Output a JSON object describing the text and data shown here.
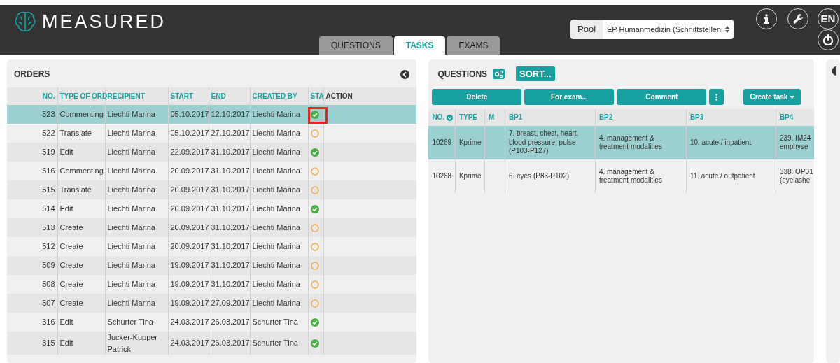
{
  "header": {
    "logo": "MEASURED",
    "tabs": [
      {
        "label": "QUESTIONS",
        "selected": false
      },
      {
        "label": "TASKS",
        "selected": true
      },
      {
        "label": "EXAMS",
        "selected": false
      }
    ],
    "pool": {
      "label": "Pool",
      "value": "EP Humanmedizin (Schnittstellen"
    },
    "language": "EN"
  },
  "orders": {
    "title": "ORDERS",
    "columns": [
      "NO.",
      "TYPE OF ORD",
      "RECIPIENT",
      "START",
      "END",
      "CREATED BY",
      "STA",
      "ACTION"
    ],
    "rows": [
      {
        "no": "523",
        "type": "Commenting",
        "recipient": "Liechti Marina",
        "start": "05.10.2017",
        "end": "12.10.2017",
        "created_by": "Liechti Marina",
        "completed": true,
        "selected": true,
        "highlighted": true
      },
      {
        "no": "522",
        "type": "Translate",
        "recipient": "Liechti Marina",
        "start": "05.10.2017",
        "end": "27.10.2017",
        "created_by": "Liechti Marina",
        "completed": false,
        "selected": false,
        "highlighted": false
      },
      {
        "no": "519",
        "type": "Edit",
        "recipient": "Liechti Marina",
        "start": "22.09.2017",
        "end": "31.10.2017",
        "created_by": "Liechti Marina",
        "completed": true,
        "selected": false,
        "highlighted": false
      },
      {
        "no": "516",
        "type": "Commenting",
        "recipient": "Liechti Marina",
        "start": "20.09.2017",
        "end": "31.10.2017",
        "created_by": "Liechti Marina",
        "completed": false,
        "selected": false,
        "highlighted": false
      },
      {
        "no": "515",
        "type": "Translate",
        "recipient": "Liechti Marina",
        "start": "20.09.2017",
        "end": "31.10.2017",
        "created_by": "Liechti Marina",
        "completed": false,
        "selected": false,
        "highlighted": false
      },
      {
        "no": "514",
        "type": "Edit",
        "recipient": "Liechti Marina",
        "start": "20.09.2017",
        "end": "31.10.2017",
        "created_by": "Liechti Marina",
        "completed": true,
        "selected": false,
        "highlighted": false
      },
      {
        "no": "513",
        "type": "Create",
        "recipient": "Liechti Marina",
        "start": "20.09.2017",
        "end": "31.10.2017",
        "created_by": "Liechti Marina",
        "completed": false,
        "selected": false,
        "highlighted": false
      },
      {
        "no": "512",
        "type": "Create",
        "recipient": "Liechti Marina",
        "start": "20.09.2017",
        "end": "31.10.2017",
        "created_by": "Liechti Marina",
        "completed": false,
        "selected": false,
        "highlighted": false
      },
      {
        "no": "509",
        "type": "Create",
        "recipient": "Liechti Marina",
        "start": "19.09.2017",
        "end": "31.10.2017",
        "created_by": "Liechti Marina",
        "completed": false,
        "selected": false,
        "highlighted": false
      },
      {
        "no": "508",
        "type": "Create",
        "recipient": "Liechti Marina",
        "start": "19.09.2017",
        "end": "31.10.2017",
        "created_by": "Liechti Marina",
        "completed": false,
        "selected": false,
        "highlighted": false
      },
      {
        "no": "507",
        "type": "Create",
        "recipient": "Liechti Marina",
        "start": "19.09.2017",
        "end": "27.09.2017",
        "created_by": "Liechti Marina",
        "completed": false,
        "selected": false,
        "highlighted": false
      },
      {
        "no": "316",
        "type": "Edit",
        "recipient": "Schurter Tina",
        "start": "24.03.2017",
        "end": "26.03.2017",
        "created_by": "Schurter Tina",
        "completed": true,
        "selected": false,
        "highlighted": false
      },
      {
        "no": "315",
        "type": "Edit",
        "recipient": "Jucker-Kupper Patrick",
        "start": "24.03.2017",
        "end": "26.03.2017",
        "created_by": "Schurter Tina",
        "completed": true,
        "selected": false,
        "highlighted": false
      }
    ]
  },
  "questions": {
    "title": "QUESTIONS",
    "sort_button": "SORT...",
    "actions": [
      "Delete",
      "For exam...",
      "Comment"
    ],
    "create_task": "Create task",
    "columns": [
      "NO.",
      "TYPE",
      "M",
      "BP1",
      "BP2",
      "BP3",
      "BP4"
    ],
    "rows": [
      {
        "no": "10269",
        "type": "Kprime",
        "bp1": "7. breast, chest, heart, blood pressure, pulse (P103-P127)",
        "bp2": "4. management & treatment modalities",
        "bp3": "10. acute / inpatient",
        "bp4": "239. IM24 emphyse",
        "selected": true
      },
      {
        "no": "10268",
        "type": "Kprime",
        "bp1": "6. eyes (P83-P102)",
        "bp2": "4. management & treatment modalities",
        "bp3": "11. acute / outpatient",
        "bp4": "338. OP01 (eyelashe",
        "selected": false
      }
    ]
  }
}
